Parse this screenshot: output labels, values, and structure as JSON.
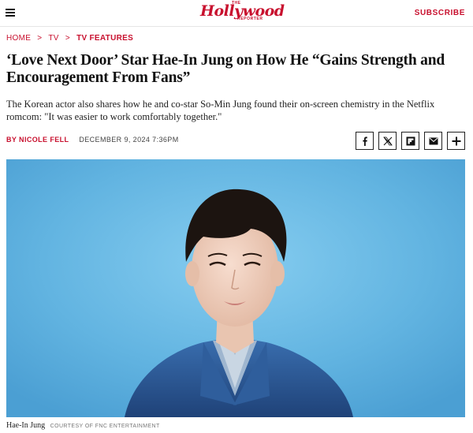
{
  "header": {
    "logo_the": "THE",
    "logo_main": "Hollywood",
    "logo_sub": "REPORTER",
    "subscribe_label": "SUBSCRIBE",
    "brand_color": "#c8102e"
  },
  "breadcrumb": {
    "items": [
      "HOME",
      "TV",
      "TV FEATURES"
    ],
    "separator": ">"
  },
  "article": {
    "headline": "‘Love Next Door’ Star Hae-In Jung on How He “Gains Strength and Encouragement From Fans”",
    "dek": "The Korean actor also shares how he and co-star So-Min Jung found their on-screen chemistry in the Netflix romcom: \"It was easier to work comfortably together.\"",
    "author": "BY NICOLE FELL",
    "date": "DECEMBER 9, 2024 7:36PM"
  },
  "share": {
    "icons": [
      "facebook-icon",
      "x-icon",
      "flipboard-icon",
      "email-icon",
      "plus-icon"
    ]
  },
  "image": {
    "caption": "Hae-In Jung",
    "credit": "COURTESY OF FNC ENTERTAINMENT",
    "background_color": "#5fb2e0"
  }
}
